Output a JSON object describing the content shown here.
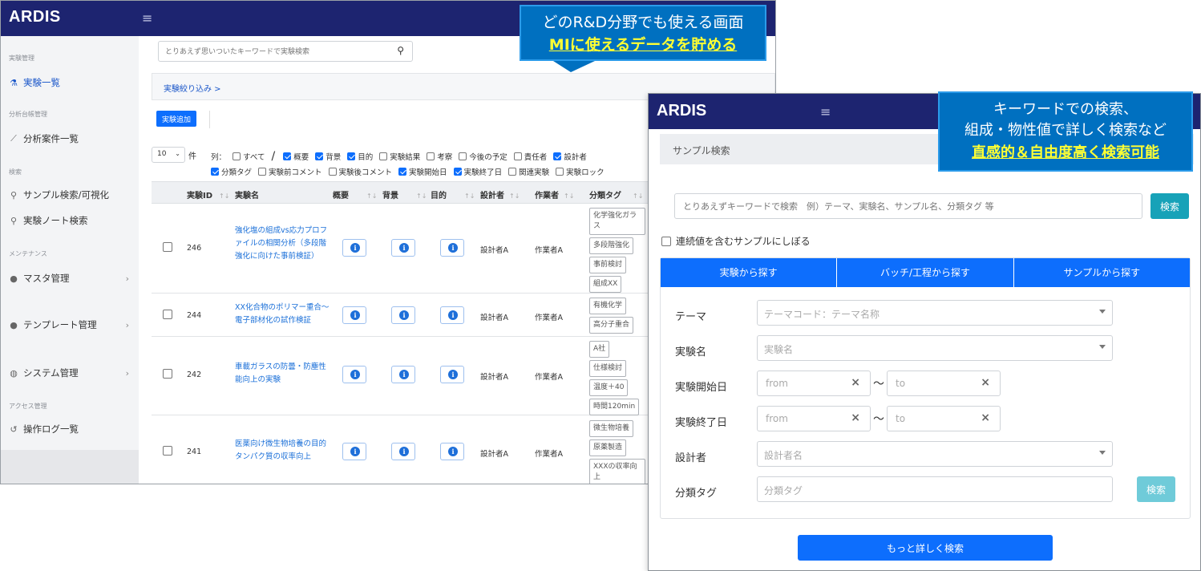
{
  "list_window": {
    "logo": "ARDIS",
    "sidebar": {
      "sections": [
        {
          "label": "実験管理"
        },
        {
          "label": "分析台帳管理"
        },
        {
          "label": "検索"
        },
        {
          "label": "メンテナンス"
        },
        {
          "label": "アクセス管理"
        }
      ],
      "items": [
        {
          "label": "実験一覧",
          "icon": "flask-icon"
        },
        {
          "label": "分析案件一覧",
          "icon": "chart-line-icon"
        },
        {
          "label": "サンプル検索/可視化",
          "icon": "search-icon"
        },
        {
          "label": "実験ノート検索",
          "icon": "search-icon"
        },
        {
          "label": "マスタ管理",
          "icon": "user-icon"
        },
        {
          "label": "テンプレート管理",
          "icon": "user-icon"
        },
        {
          "label": "システム管理",
          "icon": "users-icon"
        },
        {
          "label": "操作ログ一覧",
          "icon": "history-icon"
        }
      ]
    },
    "search": {
      "placeholder": "とりあえず思いついたキーワードで実験検索"
    },
    "filter_link": "実験絞り込み >",
    "add_button": "実験追加",
    "per_page": "10",
    "per_page_unit": "件",
    "columns_label": "列：",
    "column_toggles_row1": [
      {
        "label": "すべて",
        "checked": false
      },
      {
        "label": "概要",
        "checked": true
      },
      {
        "label": "背景",
        "checked": true
      },
      {
        "label": "目的",
        "checked": true
      },
      {
        "label": "実験結果",
        "checked": false
      },
      {
        "label": "考察",
        "checked": false
      },
      {
        "label": "今後の予定",
        "checked": false
      },
      {
        "label": "責任者",
        "checked": false
      },
      {
        "label": "設計者",
        "checked": true
      }
    ],
    "column_toggles_row2": [
      {
        "label": "分類タグ",
        "checked": true
      },
      {
        "label": "実験前コメント",
        "checked": false
      },
      {
        "label": "実験後コメント",
        "checked": false
      },
      {
        "label": "実験開始日",
        "checked": true
      },
      {
        "label": "実験終了日",
        "checked": true
      },
      {
        "label": "関連実験",
        "checked": false
      },
      {
        "label": "実験ロック",
        "checked": false
      }
    ],
    "table": {
      "headers": [
        "実験ID",
        "実験名",
        "概要",
        "背景",
        "目的",
        "設計者",
        "作業者",
        "分類タグ"
      ],
      "rows": [
        {
          "id": "246",
          "name": "強化塩の組成vs応力プロファイルの相関分析（多段階強化に向けた事前検証）",
          "designer": "設計者A",
          "worker": "作業者A",
          "tags": [
            "化学強化ガラス",
            "多段階強化",
            "事前検討",
            "組成XX"
          ]
        },
        {
          "id": "244",
          "name": "XX化合物のポリマー重合〜電子部材化の試作検証",
          "designer": "設計者A",
          "worker": "作業者A",
          "tags": [
            "有機化学",
            "高分子重合"
          ]
        },
        {
          "id": "242",
          "name": "車載ガラスの防曇・防塵性能向上の実験",
          "designer": "設計者A",
          "worker": "作業者A",
          "tags": [
            "A社",
            "仕様検討",
            "温度＋40",
            "時間120min"
          ]
        },
        {
          "id": "241",
          "name": "医薬向け微生物培養の目的タンパク質の収率向上",
          "designer": "設計者A",
          "worker": "作業者A",
          "tags": [
            "微生物培養",
            "原薬製造",
            "XXXの収率向上"
          ]
        }
      ]
    }
  },
  "callout1": {
    "line1": "どのR&D分野でも使える画面",
    "line2": "MIに使えるデータを貯める"
  },
  "callout2": {
    "line1": "キーワードでの検索、",
    "line2": "組成・物性値で詳しく検索など",
    "line3": "直感的＆自由度高く検索可能"
  },
  "search_window": {
    "logo": "ARDIS",
    "title": "サンプル検索",
    "keyword_placeholder": "とりあえずキーワードで検索　例）テーマ、実験名、サンプル名、分類タグ 等",
    "search_button": "検索",
    "continuous_filter": "連続値を含むサンプルにしぼる",
    "tabs": [
      "実験から探す",
      "バッチ/工程から探す",
      "サンプルから探す"
    ],
    "fields": {
      "theme": {
        "label": "テーマ",
        "placeholder": "テーマコード：テーマ名称"
      },
      "exp_name": {
        "label": "実験名",
        "placeholder": "実験名"
      },
      "start_date": {
        "label": "実験開始日",
        "from": "from",
        "to": "to"
      },
      "end_date": {
        "label": "実験終了日",
        "from": "from",
        "to": "to"
      },
      "designer": {
        "label": "設計者",
        "placeholder": "設計者名"
      },
      "tag": {
        "label": "分類タグ",
        "placeholder": "分類タグ",
        "button": "検索"
      }
    },
    "tilde": "〜",
    "more_button": "もっと詳しく検索"
  }
}
